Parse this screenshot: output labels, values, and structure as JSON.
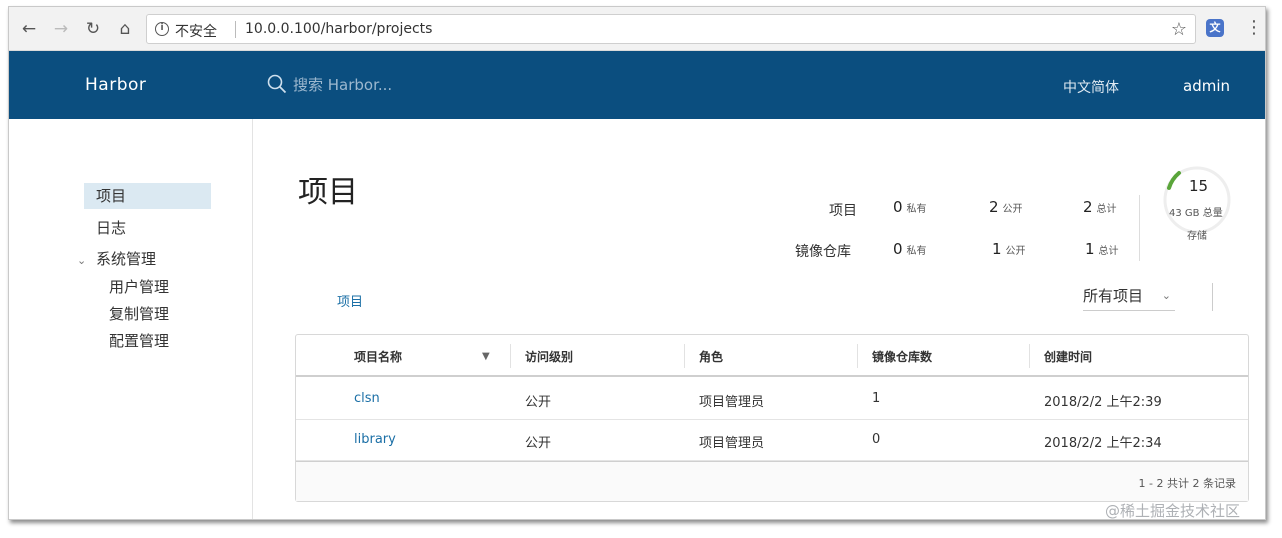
{
  "browser": {
    "security_label": "不安全",
    "url": "10.0.0.100/harbor/projects"
  },
  "header": {
    "brand": "Harbor",
    "search_placeholder": "搜索 Harbor...",
    "language": "中文简体",
    "user": "admin"
  },
  "sidebar": {
    "items": [
      {
        "label": "项目"
      },
      {
        "label": "日志"
      },
      {
        "label": "系统管理"
      },
      {
        "label": "用户管理"
      },
      {
        "label": "复制管理"
      },
      {
        "label": "配置管理"
      }
    ]
  },
  "main": {
    "title": "项目",
    "stats": {
      "projects_label": "项目",
      "repos_label": "镜像仓库",
      "private_label": "私有",
      "public_label": "公开",
      "total_label": "总计",
      "projects": {
        "private": "0",
        "public": "2",
        "total": "2"
      },
      "repos": {
        "private": "0",
        "public": "1",
        "total": "1"
      }
    },
    "quota": {
      "count": "15",
      "size": "43 GB 总量",
      "label": "存储"
    },
    "tab": "项目",
    "filter": "所有项目"
  },
  "table": {
    "headers": [
      "项目名称",
      "访问级别",
      "角色",
      "镜像仓库数",
      "创建时间"
    ],
    "rows": [
      {
        "name": "clsn",
        "access": "公开",
        "role": "项目管理员",
        "repos": "1",
        "created": "2018/2/2 上午2:39"
      },
      {
        "name": "library",
        "access": "公开",
        "role": "项目管理员",
        "repos": "0",
        "created": "2018/2/2 上午2:34"
      }
    ],
    "pagination": "1 - 2 共计 2 条记录"
  },
  "watermark": "@稀土掘金技术社区",
  "colors": {
    "header_bg": "#0b4e7f",
    "link": "#1b6fa6",
    "active_sidebar": "#dbe9f2",
    "quota_arc": "#5aa53a"
  }
}
